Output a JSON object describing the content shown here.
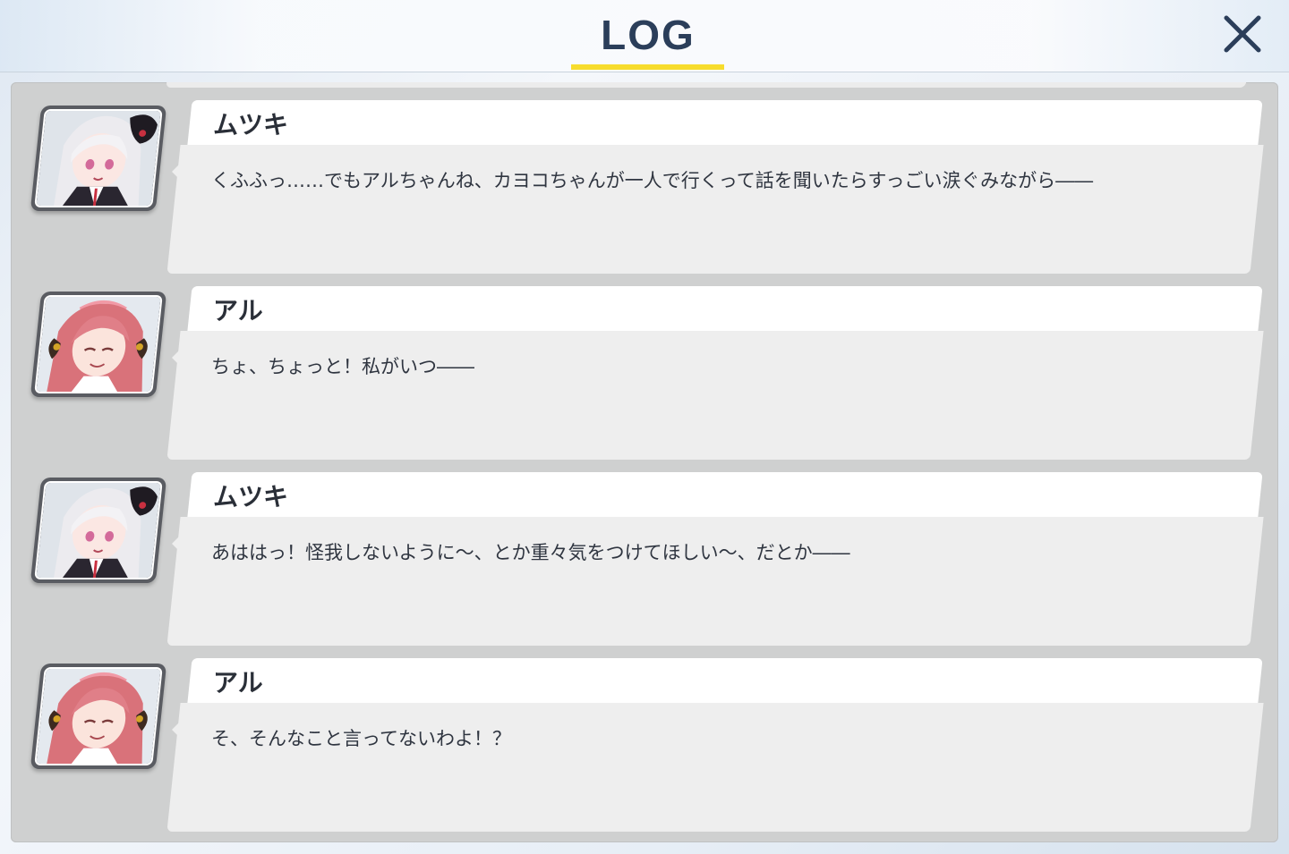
{
  "header": {
    "title": "LOG",
    "accent_color": "#f7dc2d",
    "close_icon": "close-icon"
  },
  "log": {
    "entries": [
      {
        "speaker": "ムツキ",
        "avatar": "mutsuki-portrait",
        "text": "くふふっ……でもアルちゃんね、カヨコちゃんが一人で行くって話を聞いたらすっごい涙ぐみながら――"
      },
      {
        "speaker": "アル",
        "avatar": "aru-portrait",
        "text": "ちょ、ちょっと！私がいつ――"
      },
      {
        "speaker": "ムツキ",
        "avatar": "mutsuki-portrait",
        "text": "あははっ！怪我しないように～、とか重々気をつけてほしい～、だとか――"
      },
      {
        "speaker": "アル",
        "avatar": "aru-portrait",
        "text": "そ、そんなこと言ってないわよ！？"
      }
    ]
  }
}
